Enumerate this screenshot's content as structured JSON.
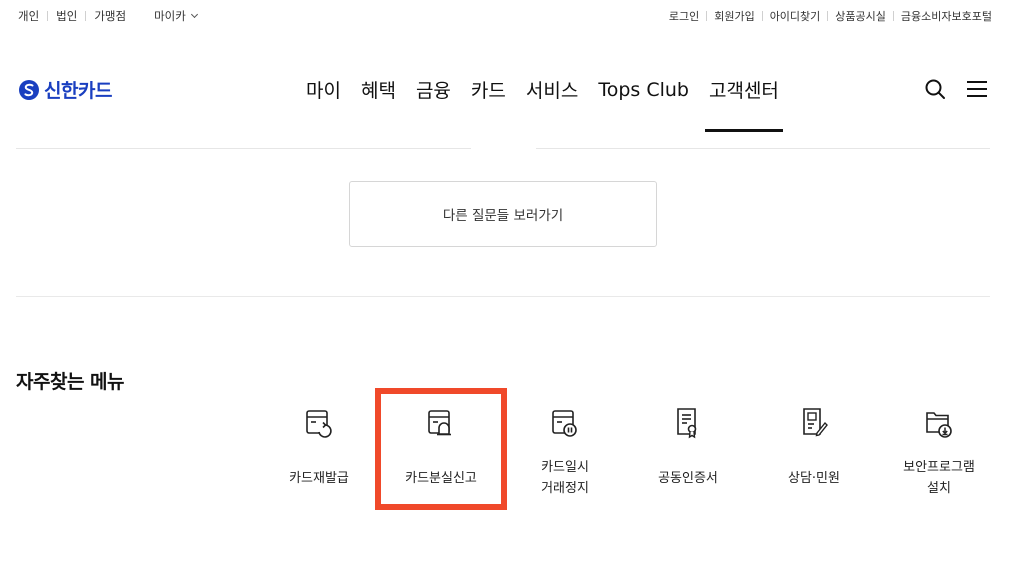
{
  "util": {
    "left": [
      "개인",
      "법인",
      "가맹점"
    ],
    "myika": "마이카",
    "right": [
      "로그인",
      "회원가입",
      "아이디찾기",
      "상품공시실",
      "금융소비자보호포털"
    ]
  },
  "header": {
    "logo_text": "신한카드",
    "nav": [
      "마이",
      "혜택",
      "금융",
      "카드",
      "서비스",
      "Tops Club",
      "고객센터"
    ],
    "active_nav": "고객센터"
  },
  "other_questions_button": "다른 질문들 보러가기",
  "frequent_menu": {
    "title": "자주찾는 메뉴",
    "items": [
      {
        "line1": "카드재발급",
        "line2": "",
        "icon": "card-reissue-icon"
      },
      {
        "line1": "카드분실신고",
        "line2": "",
        "icon": "card-lost-report-icon"
      },
      {
        "line1": "카드일시",
        "line2": "거래정지",
        "icon": "card-suspend-icon"
      },
      {
        "line1": "공동인증서",
        "line2": "",
        "icon": "certificate-icon"
      },
      {
        "line1": "상담·민원",
        "line2": "",
        "icon": "consultation-icon"
      },
      {
        "line1": "보안프로그램",
        "line2": "설치",
        "icon": "security-install-icon"
      }
    ]
  },
  "colors": {
    "brand": "#1a3fc0",
    "highlight": "#f0492a"
  }
}
